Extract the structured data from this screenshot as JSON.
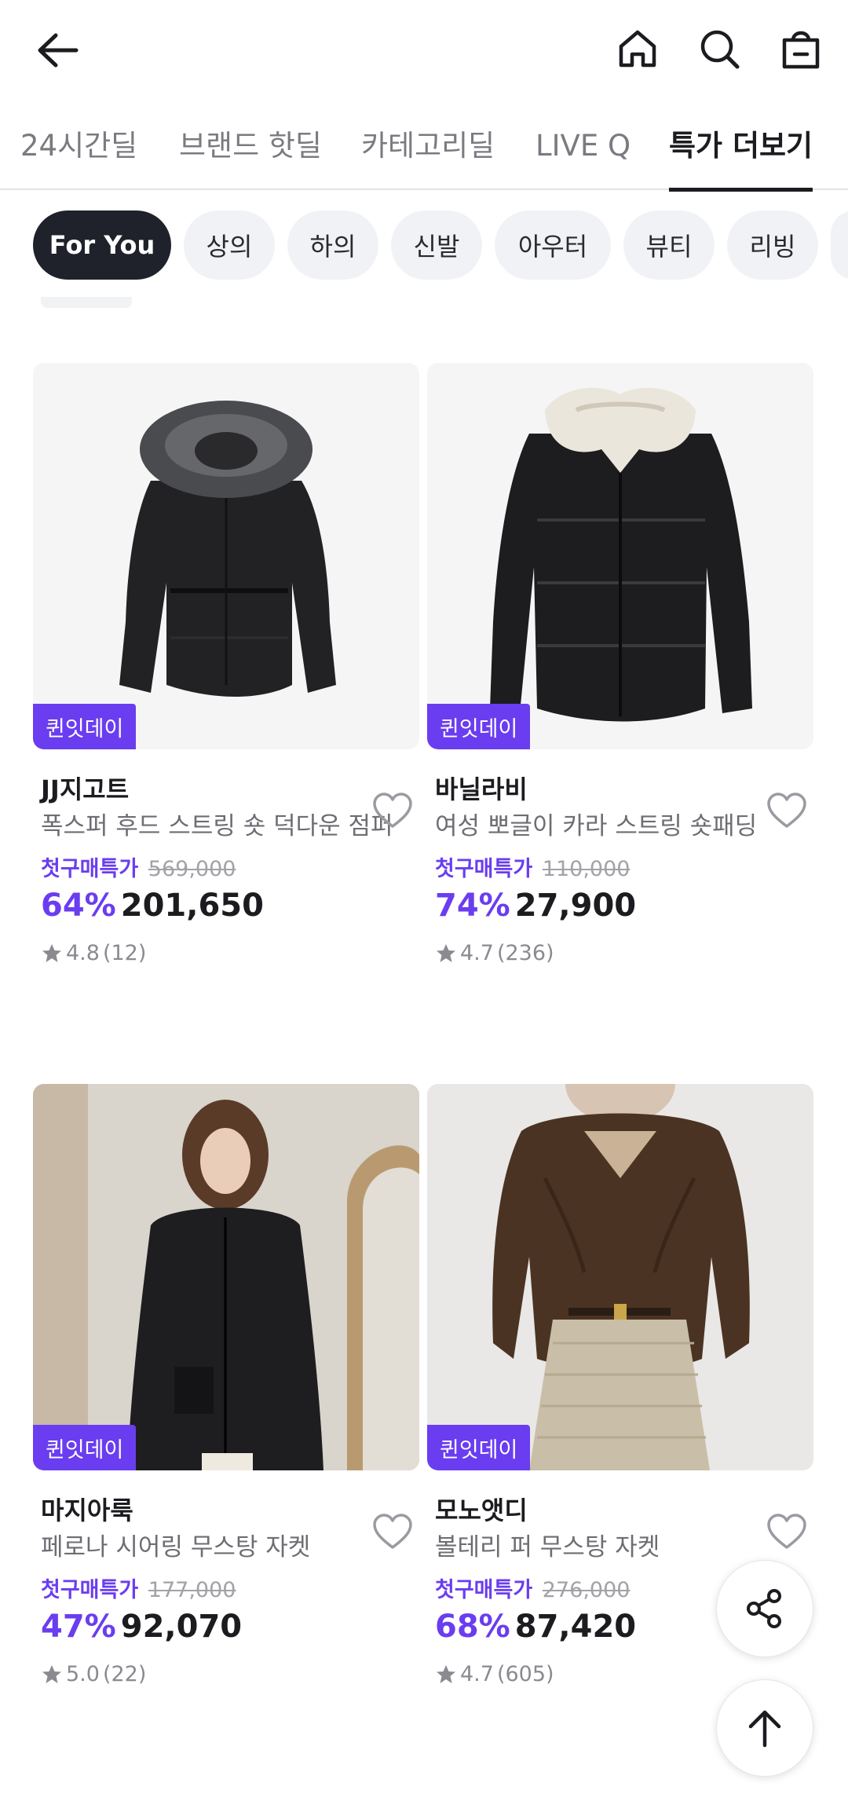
{
  "header": {
    "back_icon": "arrow-left-icon",
    "icons": [
      "home-icon",
      "search-icon",
      "shopping-bag-icon"
    ]
  },
  "deal_tabs": [
    {
      "label": "24시간딜",
      "active": false
    },
    {
      "label": "브랜드 핫딜",
      "active": false
    },
    {
      "label": "카테고리딜",
      "active": false
    },
    {
      "label": "LIVE Q",
      "active": false
    },
    {
      "label": "특가 더보기",
      "active": true
    }
  ],
  "chips": [
    {
      "label": "For You",
      "active": true
    },
    {
      "label": "상의",
      "active": false
    },
    {
      "label": "하의",
      "active": false
    },
    {
      "label": "신발",
      "active": false
    },
    {
      "label": "아우터",
      "active": false
    },
    {
      "label": "뷰티",
      "active": false
    },
    {
      "label": "리빙",
      "active": false
    }
  ],
  "products": [
    {
      "badge": "퀸잇데이",
      "brand": "JJ지고트",
      "name": "폭스퍼 후드 스트링 숏 덕다운 점퍼",
      "price_label": "첫구매특가",
      "original_price": "569,000",
      "discount": "64%",
      "price": "201,650",
      "rating": "4.8",
      "review_count": "(12)",
      "image": "black-fur-hood-puffer-jacket"
    },
    {
      "badge": "퀸잇데이",
      "brand": "바닐라비",
      "name": "여성 뽀글이 카라 스트링 숏패딩",
      "price_label": "첫구매특가",
      "original_price": "110,000",
      "discount": "74%",
      "price": "27,900",
      "rating": "4.7",
      "review_count": "(236)",
      "image": "black-puffer-with-fleece-collar"
    },
    {
      "badge": "퀸잇데이",
      "brand": "마지아룩",
      "name": "페로나 시어링 무스탕 자켓",
      "price_label": "첫구매특가",
      "original_price": "177,000",
      "discount": "47%",
      "price": "92,070",
      "rating": "5.0",
      "review_count": "(22)",
      "image": "model-in-black-shearling-jacket"
    },
    {
      "badge": "퀸잇데이",
      "brand": "모노앳디",
      "name": "볼테리 퍼 무스탕 자켓",
      "price_label": "첫구매특가",
      "original_price": "276,000",
      "discount": "68%",
      "price": "87,420",
      "rating": "4.7",
      "review_count": "(605)",
      "image": "model-in-brown-fur-jacket"
    }
  ],
  "floating": {
    "share_icon": "share-icon",
    "top_icon": "arrow-up-icon"
  },
  "colors": {
    "accent": "#6a3df0",
    "chip_active_bg": "#1f222b",
    "chip_bg": "#f1f2f6"
  }
}
